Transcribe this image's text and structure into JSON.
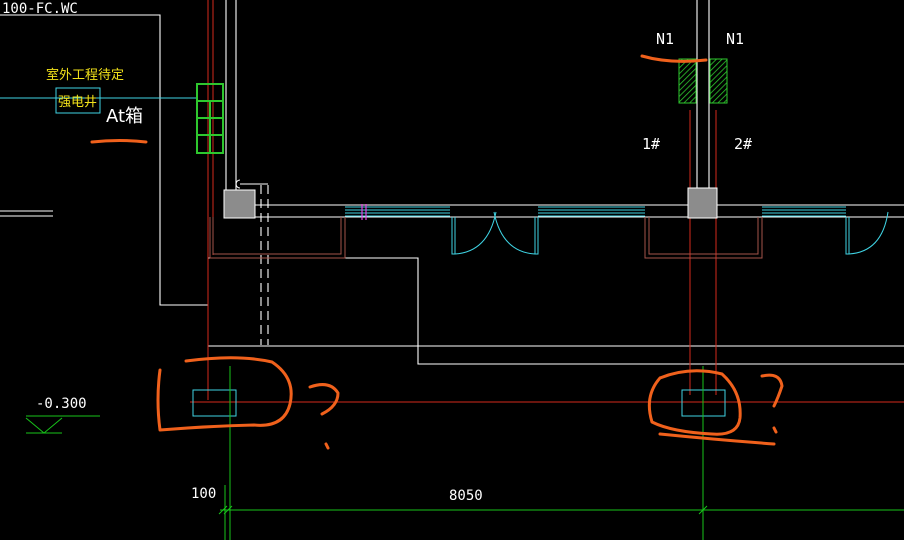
{
  "drawing": {
    "corner_label": "100-FC.WC",
    "annotation_line1": "室外工程待定",
    "annotation_line2": "强电井",
    "box_label": "At箱",
    "n1_left": "N1",
    "n1_right": "N1",
    "mark_1": "1#",
    "mark_2": "2#",
    "elevation": "-0.300",
    "dim_small": "100",
    "dim_main": "8050"
  },
  "colors": {
    "background": "#000000",
    "wall": "#ffffff",
    "axis_red": "#d42a1c",
    "axis_green": "#17c41a",
    "cyan": "#3fd4e4",
    "brown": "#a4554a",
    "yellow": "#f2e21a",
    "markup_orange": "#f0611c",
    "magenta": "#e040e0",
    "green_hatch": "#2ec72e",
    "column_grey": "#8c8c8c"
  }
}
